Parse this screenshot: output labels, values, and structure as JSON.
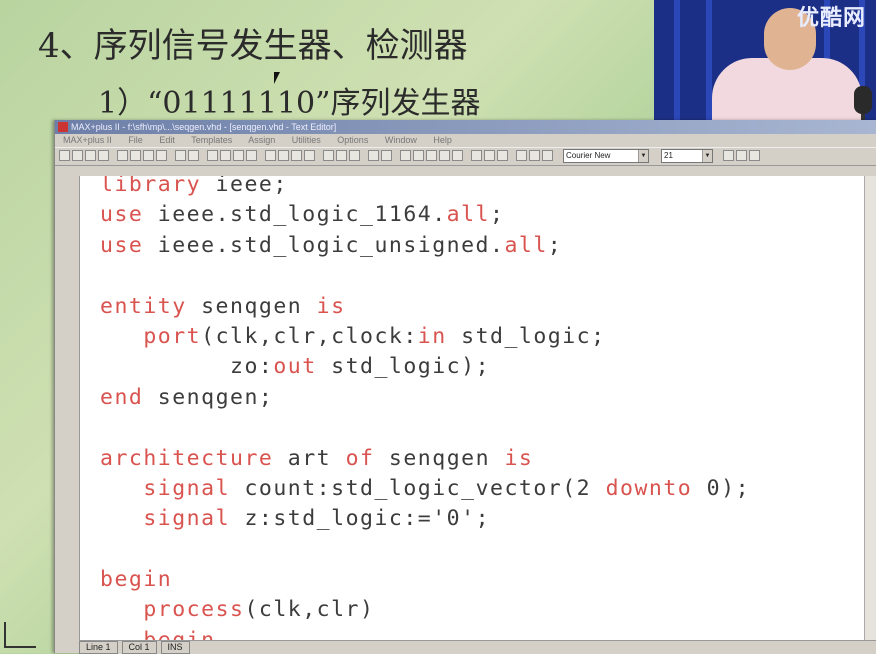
{
  "slide": {
    "heading": "4、序列信号发生器、检测器",
    "subheading": "1）“01111110”序列发生器"
  },
  "video": {
    "watermark": "优酷网"
  },
  "window": {
    "title": "MAX+plus II - f:\\sfh\\mp\\...\\seqgen.vhd - [senqgen.vhd - Text Editor]",
    "menus": [
      "MAX+plus II",
      "File",
      "Edit",
      "Templates",
      "Assign",
      "Utilities",
      "Options",
      "Window",
      "Help"
    ],
    "font_select": "Courier New",
    "size_select": "21"
  },
  "code": {
    "lines": [
      [
        {
          "t": "library",
          "k": true
        },
        {
          "t": " ieee;"
        }
      ],
      [
        {
          "t": "use",
          "k": true
        },
        {
          "t": " ieee.std_logic_1164."
        },
        {
          "t": "all",
          "k": true
        },
        {
          "t": ";"
        }
      ],
      [
        {
          "t": "use",
          "k": true
        },
        {
          "t": " ieee.std_logic_unsigned."
        },
        {
          "t": "all",
          "k": true
        },
        {
          "t": ";"
        }
      ],
      [],
      [
        {
          "t": "entity",
          "k": true
        },
        {
          "t": " senqgen "
        },
        {
          "t": "is",
          "k": true
        }
      ],
      [
        {
          "t": "   "
        },
        {
          "t": "port",
          "k": true
        },
        {
          "t": "(clk,clr,clock:"
        },
        {
          "t": "in",
          "k": true
        },
        {
          "t": " std_logic;"
        }
      ],
      [
        {
          "t": "         zo:"
        },
        {
          "t": "out",
          "k": true
        },
        {
          "t": " std_logic);"
        }
      ],
      [
        {
          "t": "end",
          "k": true
        },
        {
          "t": " senqgen;"
        }
      ],
      [],
      [
        {
          "t": "architecture",
          "k": true
        },
        {
          "t": " art "
        },
        {
          "t": "of",
          "k": true
        },
        {
          "t": " senqgen "
        },
        {
          "t": "is",
          "k": true
        }
      ],
      [
        {
          "t": "   "
        },
        {
          "t": "signal",
          "k": true
        },
        {
          "t": " count:std_logic_vector(2 "
        },
        {
          "t": "downto",
          "k": true
        },
        {
          "t": " 0);"
        }
      ],
      [
        {
          "t": "   "
        },
        {
          "t": "signal",
          "k": true
        },
        {
          "t": " z:std_logic:='0';"
        }
      ],
      [],
      [
        {
          "t": "begin",
          "k": true
        }
      ],
      [
        {
          "t": "   "
        },
        {
          "t": "process",
          "k": true
        },
        {
          "t": "(clk,clr)"
        }
      ],
      [
        {
          "t": "   "
        },
        {
          "t": "begin",
          "k": true
        }
      ]
    ],
    "keyword_color": "#d9534f",
    "text_color": "#3c3c3c"
  },
  "status": {
    "line": "Line  1",
    "col": "Col  1",
    "mode": "INS"
  }
}
